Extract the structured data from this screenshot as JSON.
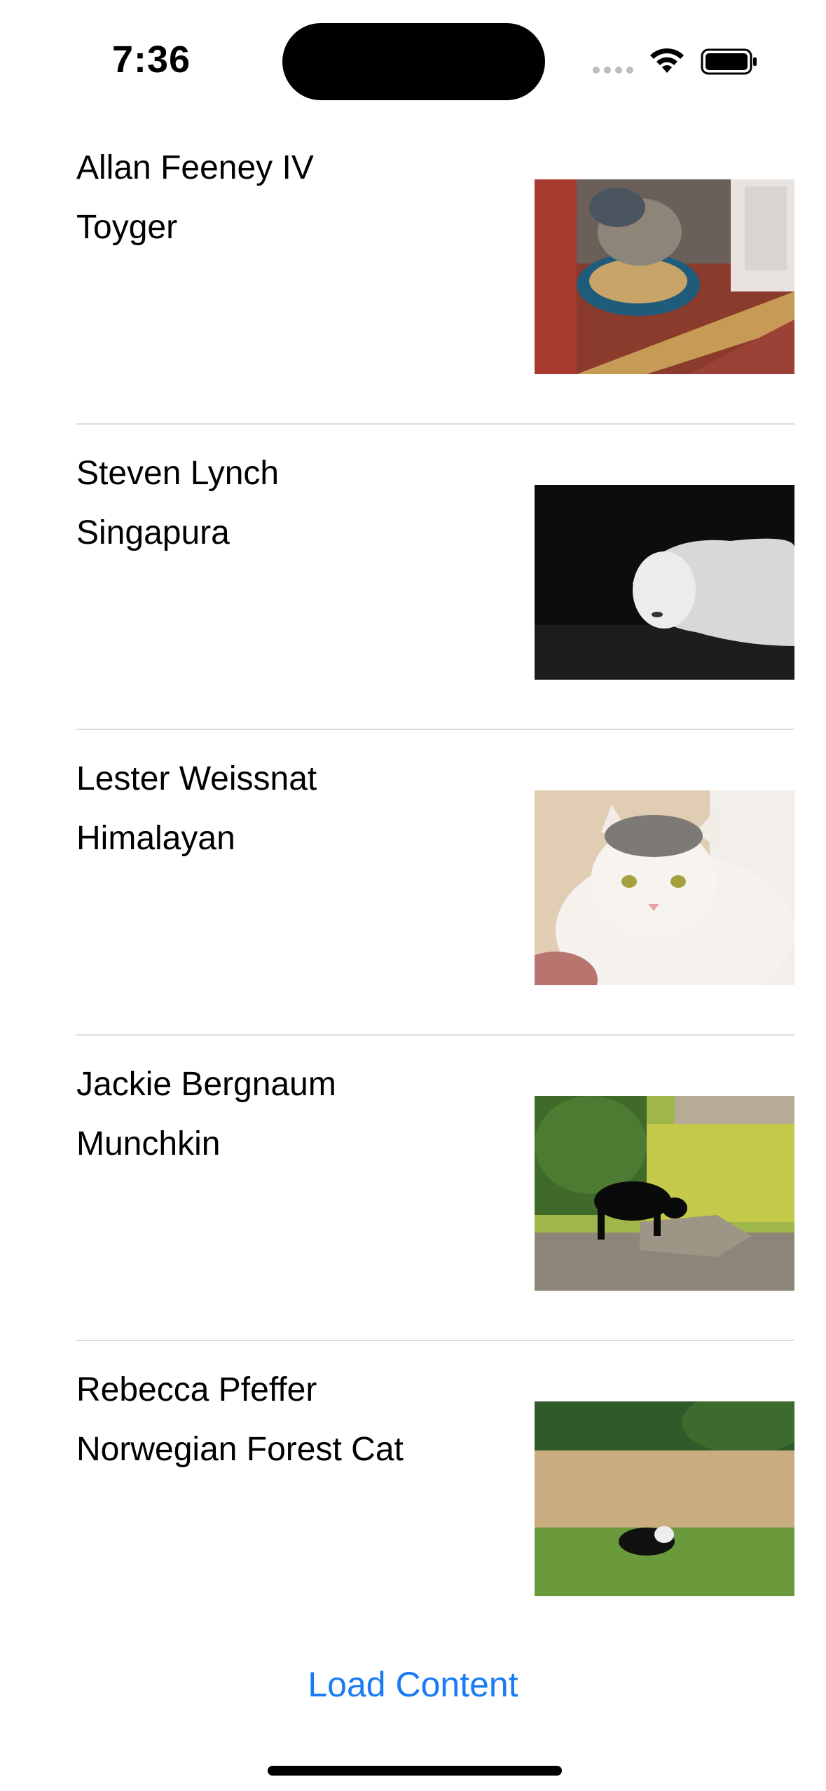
{
  "status_bar": {
    "time": "7:36",
    "icons": [
      "signal-icon",
      "wifi-icon",
      "battery-icon"
    ]
  },
  "cats": [
    {
      "name": "Allan Feeney IV",
      "breed": "Toyger",
      "photo": "cat-on-scratcher-toy"
    },
    {
      "name": "Steven Lynch",
      "breed": "Singapura",
      "photo": "white-cat-dark-background"
    },
    {
      "name": "Lester Weissnat",
      "breed": "Himalayan",
      "photo": "fluffy-white-cat"
    },
    {
      "name": "Jackie Bergnaum",
      "breed": "Munchkin",
      "photo": "black-cat-on-rocks"
    },
    {
      "name": "Rebecca Pfeffer",
      "breed": "Norwegian Forest Cat",
      "photo": "cat-in-field"
    }
  ],
  "load_button_label": "Load Content",
  "colors": {
    "accent": "#1a7cf5",
    "divider": "#dcdcdc"
  }
}
